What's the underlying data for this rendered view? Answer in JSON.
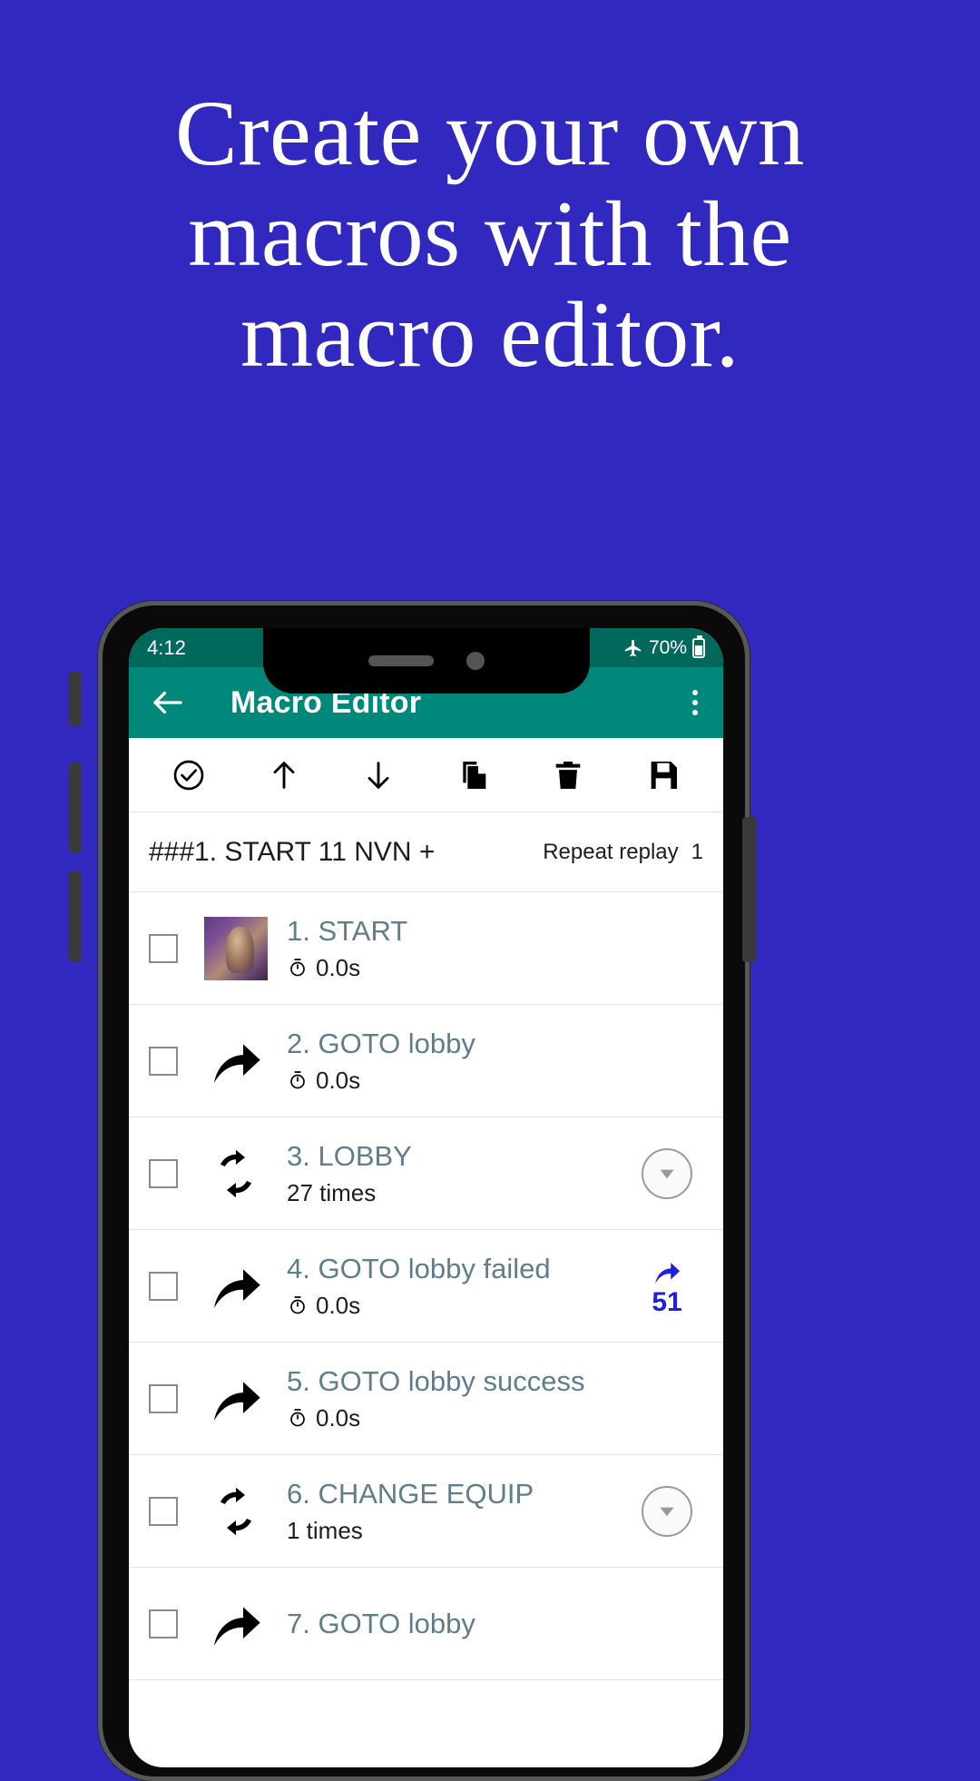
{
  "promo": {
    "headline_lines": [
      "Create your own",
      "macros with the",
      "macro editor."
    ],
    "background_color": "#3028bf",
    "text_color": "#ffffff"
  },
  "phone": {
    "status_bar": {
      "time": "4:12",
      "airplane_icon": "airplane-mode-icon",
      "battery_text": "70%",
      "battery_icon": "battery-icon",
      "background_color": "#00695c"
    },
    "app_bar": {
      "back_icon": "back-arrow-icon",
      "title": "Macro Editor",
      "overflow_icon": "overflow-menu-icon",
      "background_color": "#00897b"
    },
    "toolbar": {
      "items": [
        {
          "name": "check-circle-icon",
          "label": "Select all"
        },
        {
          "name": "arrow-up-icon",
          "label": "Move up"
        },
        {
          "name": "arrow-down-icon",
          "label": "Move down"
        },
        {
          "name": "copy-icon",
          "label": "Duplicate"
        },
        {
          "name": "trash-icon",
          "label": "Delete"
        },
        {
          "name": "save-icon",
          "label": "Save"
        }
      ]
    },
    "macro_header": {
      "name": "###1. START 11 NVN +",
      "repeat_label": "Repeat replay",
      "repeat_value": "1"
    },
    "list": {
      "rows": [
        {
          "checkbox": "unchecked",
          "icon": "macro-thumbnail-image",
          "title": "1. START",
          "sub_icon": "stopwatch-icon",
          "sub": "0.0s",
          "right_type": "none",
          "right_value": ""
        },
        {
          "checkbox": "unchecked",
          "icon": "goto-arrow-icon",
          "title": "2. GOTO lobby",
          "sub_icon": "stopwatch-icon",
          "sub": "0.0s",
          "right_type": "none",
          "right_value": ""
        },
        {
          "checkbox": "unchecked",
          "icon": "loop-icon",
          "title": "3. LOBBY",
          "sub_icon": "",
          "sub": "27 times",
          "right_type": "expand",
          "right_value": ""
        },
        {
          "checkbox": "unchecked",
          "icon": "goto-arrow-icon",
          "title": "4. GOTO lobby failed",
          "sub_icon": "stopwatch-icon",
          "sub": "0.0s",
          "right_type": "jump",
          "right_value": "51"
        },
        {
          "checkbox": "unchecked",
          "icon": "goto-arrow-icon",
          "title": "5. GOTO lobby success",
          "sub_icon": "stopwatch-icon",
          "sub": "0.0s",
          "right_type": "none",
          "right_value": ""
        },
        {
          "checkbox": "unchecked",
          "icon": "loop-icon",
          "title": "6. CHANGE EQUIP",
          "sub_icon": "",
          "sub": "1 times",
          "right_type": "expand",
          "right_value": ""
        },
        {
          "checkbox": "unchecked",
          "icon": "goto-arrow-icon",
          "title": "7. GOTO lobby",
          "sub_icon": "stopwatch-icon",
          "sub": "",
          "right_type": "none",
          "right_value": ""
        }
      ]
    }
  },
  "colors": {
    "promo_bg": "#3028bf",
    "appbar_teal": "#00897b",
    "statusbar_teal": "#00695c",
    "row_title": "#5f7d8c",
    "jump_blue": "#2020d8"
  }
}
